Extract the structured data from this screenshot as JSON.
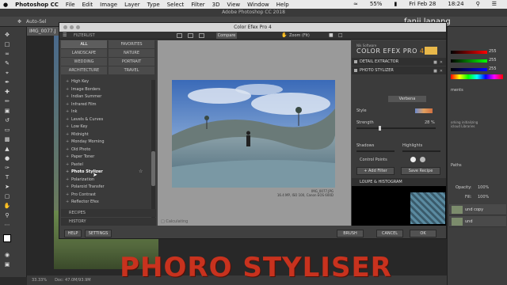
{
  "mac_menu": {
    "app": "Photoshop CC",
    "items": [
      "File",
      "Edit",
      "Image",
      "Layer",
      "Type",
      "Select",
      "Filter",
      "3D",
      "View",
      "Window",
      "Help"
    ],
    "status": [
      "55%",
      "Fri Feb 28",
      "18:24"
    ]
  },
  "ps_window_title": "Adobe Photoshop CC 2018",
  "options_bar": {
    "auto_select": "Auto-Sel"
  },
  "doc_tab": "IMG_0077.J",
  "watermark": "fanji lanang",
  "cef": {
    "title": "Color Efex Pro 4",
    "filterlist_label": "FILTERLIST",
    "compare_label": "Compare",
    "zoom_label": "Zoom (Fit)",
    "categories": [
      {
        "label": "ALL",
        "selected": true
      },
      {
        "label": "FAVORITES",
        "selected": false
      },
      {
        "label": "LANDSCAPE",
        "selected": false
      },
      {
        "label": "NATURE",
        "selected": false
      },
      {
        "label": "WEDDING",
        "selected": false
      },
      {
        "label": "PORTRAIT",
        "selected": false
      },
      {
        "label": "ARCHITECTURE",
        "selected": false
      },
      {
        "label": "TRAVEL",
        "selected": false
      }
    ],
    "filters": [
      {
        "label": "High Key"
      },
      {
        "label": "Image Borders"
      },
      {
        "label": "Indian Summer"
      },
      {
        "label": "Infrared Film"
      },
      {
        "label": "Ink"
      },
      {
        "label": "Levels & Curves"
      },
      {
        "label": "Low Key"
      },
      {
        "label": "Midnight"
      },
      {
        "label": "Monday Morning"
      },
      {
        "label": "Old Photo"
      },
      {
        "label": "Paper Toner"
      },
      {
        "label": "Pastel"
      },
      {
        "label": "Photo Stylizer",
        "selected": true
      },
      {
        "label": "Polarization"
      },
      {
        "label": "Polaroid Transfer"
      },
      {
        "label": "Pro Contrast"
      },
      {
        "label": "Reflector Efex"
      }
    ],
    "recipes_label": "RECIPES",
    "history_label": "HISTORY",
    "help_button": "HELP",
    "settings_button": "SETTINGS",
    "calculating": "Calculating",
    "photo_caption_1": "IMG_0077.JPG",
    "photo_caption_2": "16.4 MP, ISO 100, Canon EOS 600D",
    "brand_small": "Nik Software",
    "brand_large": "COLOR EFEX PRO",
    "brand_version": "4",
    "detail_extractor": "DETAIL EXTRACTOR",
    "photo_stylizer": "PHOTO STYLIZER",
    "preset_value": "Verbena",
    "style_label": "Style",
    "strength_label": "Strength",
    "strength_value": "28",
    "strength_unit": "%",
    "strength_fraction": 0.28,
    "shadows_label": "Shadows",
    "highlights_label": "Highlights",
    "control_points_label": "Control Points",
    "add_filter": "+ Add Filter",
    "save_recipe": "Save Recipe",
    "loupe_label": "LOUPE & HISTOGRAM",
    "brush_button": "BRUSH",
    "cancel_button": "CANCEL",
    "ok_button": "OK"
  },
  "right_panel": {
    "slider_values": [
      "255",
      "255",
      "255"
    ],
    "ments_label": "ments",
    "working_msg": "orking initializing\nicloud Libraries",
    "paths_label": "Paths",
    "opacity_label": "Opacity:",
    "opacity_value": "100%",
    "fill_label": "Fill:",
    "fill_value": "100%",
    "layer1": "und copy",
    "layer2": "und"
  },
  "status_bar": {
    "zoom": "33.33%",
    "doc": "Doc: 47.0M/93.9M"
  },
  "bottom_title": "PHORO STYLISER",
  "colors": {
    "accent_orange": "#f0a020",
    "title_red": "#c8321e"
  }
}
